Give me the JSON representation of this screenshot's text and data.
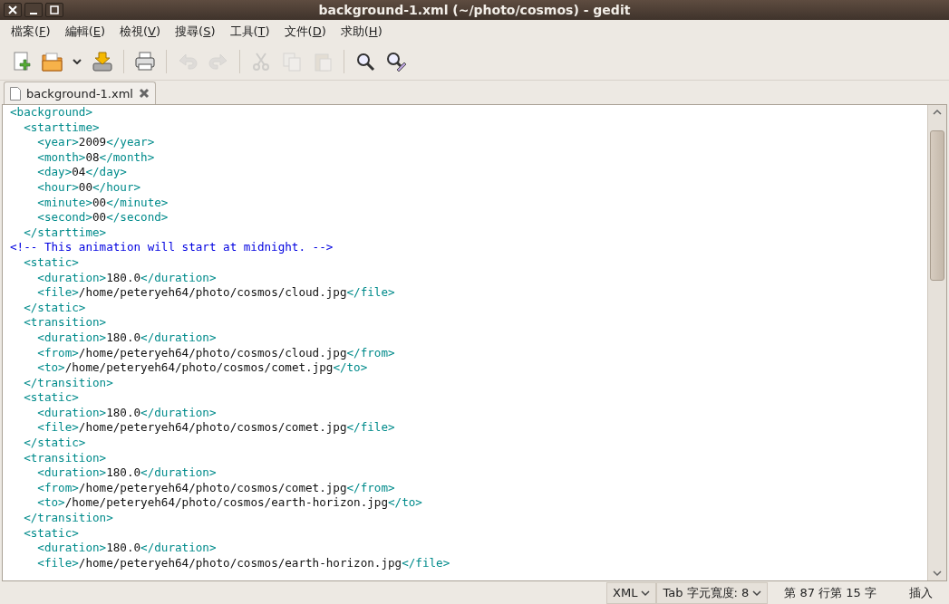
{
  "window": {
    "title": "background-1.xml (~/photo/cosmos) - gedit"
  },
  "menu": [
    {
      "before": "檔案(",
      "key": "F",
      "after": ")"
    },
    {
      "before": "編輯(",
      "key": "E",
      "after": ")"
    },
    {
      "before": "檢視(",
      "key": "V",
      "after": ")"
    },
    {
      "before": "搜尋(",
      "key": "S",
      "after": ")"
    },
    {
      "before": "工具(",
      "key": "T",
      "after": ")"
    },
    {
      "before": "文件(",
      "key": "D",
      "after": ")"
    },
    {
      "before": "求助(",
      "key": "H",
      "after": ")"
    }
  ],
  "toolbar": [
    {
      "kind": "new",
      "disabled": false
    },
    {
      "kind": "open",
      "disabled": false
    },
    {
      "kind": "dropdown",
      "disabled": false
    },
    {
      "kind": "save",
      "disabled": false
    },
    {
      "kind": "separator"
    },
    {
      "kind": "print",
      "disabled": false
    },
    {
      "kind": "separator"
    },
    {
      "kind": "undo",
      "disabled": true
    },
    {
      "kind": "redo",
      "disabled": true
    },
    {
      "kind": "separator"
    },
    {
      "kind": "cut",
      "disabled": true
    },
    {
      "kind": "copy",
      "disabled": true
    },
    {
      "kind": "paste",
      "disabled": true
    },
    {
      "kind": "separator"
    },
    {
      "kind": "find",
      "disabled": false
    },
    {
      "kind": "replace",
      "disabled": false
    }
  ],
  "tabs": [
    {
      "label": "background-1.xml",
      "selected": true
    }
  ],
  "editor": {
    "lines": [
      [
        {
          "kind": "tag",
          "text": "<background>"
        }
      ],
      [
        {
          "kind": "tag",
          "text": "  <starttime>"
        }
      ],
      [
        {
          "kind": "tag",
          "text": "    <year>"
        },
        {
          "kind": "text",
          "text": "2009"
        },
        {
          "kind": "tag",
          "text": "</year>"
        }
      ],
      [
        {
          "kind": "tag",
          "text": "    <month>"
        },
        {
          "kind": "text",
          "text": "08"
        },
        {
          "kind": "tag",
          "text": "</month>"
        }
      ],
      [
        {
          "kind": "tag",
          "text": "    <day>"
        },
        {
          "kind": "text",
          "text": "04"
        },
        {
          "kind": "tag",
          "text": "</day>"
        }
      ],
      [
        {
          "kind": "tag",
          "text": "    <hour>"
        },
        {
          "kind": "text",
          "text": "00"
        },
        {
          "kind": "tag",
          "text": "</hour>"
        }
      ],
      [
        {
          "kind": "tag",
          "text": "    <minute>"
        },
        {
          "kind": "text",
          "text": "00"
        },
        {
          "kind": "tag",
          "text": "</minute>"
        }
      ],
      [
        {
          "kind": "tag",
          "text": "    <second>"
        },
        {
          "kind": "text",
          "text": "00"
        },
        {
          "kind": "tag",
          "text": "</second>"
        }
      ],
      [
        {
          "kind": "tag",
          "text": "  </starttime>"
        }
      ],
      [
        {
          "kind": "comment",
          "text": "<!-- This animation will start at midnight. -->"
        }
      ],
      [
        {
          "kind": "tag",
          "text": "  <static>"
        }
      ],
      [
        {
          "kind": "tag",
          "text": "    <duration>"
        },
        {
          "kind": "text",
          "text": "180.0"
        },
        {
          "kind": "tag",
          "text": "</duration>"
        }
      ],
      [
        {
          "kind": "tag",
          "text": "    <file>"
        },
        {
          "kind": "text",
          "text": "/home/peteryeh64/photo/cosmos/cloud.jpg"
        },
        {
          "kind": "tag",
          "text": "</file>"
        }
      ],
      [
        {
          "kind": "tag",
          "text": "  </static>"
        }
      ],
      [
        {
          "kind": "tag",
          "text": "  <transition>"
        }
      ],
      [
        {
          "kind": "tag",
          "text": "    <duration>"
        },
        {
          "kind": "text",
          "text": "180.0"
        },
        {
          "kind": "tag",
          "text": "</duration>"
        }
      ],
      [
        {
          "kind": "tag",
          "text": "    <from>"
        },
        {
          "kind": "text",
          "text": "/home/peteryeh64/photo/cosmos/cloud.jpg"
        },
        {
          "kind": "tag",
          "text": "</from>"
        }
      ],
      [
        {
          "kind": "tag",
          "text": "    <to>"
        },
        {
          "kind": "text",
          "text": "/home/peteryeh64/photo/cosmos/comet.jpg"
        },
        {
          "kind": "tag",
          "text": "</to>"
        }
      ],
      [
        {
          "kind": "tag",
          "text": "  </transition>"
        }
      ],
      [
        {
          "kind": "tag",
          "text": "  <static>"
        }
      ],
      [
        {
          "kind": "tag",
          "text": "    <duration>"
        },
        {
          "kind": "text",
          "text": "180.0"
        },
        {
          "kind": "tag",
          "text": "</duration>"
        }
      ],
      [
        {
          "kind": "tag",
          "text": "    <file>"
        },
        {
          "kind": "text",
          "text": "/home/peteryeh64/photo/cosmos/comet.jpg"
        },
        {
          "kind": "tag",
          "text": "</file>"
        }
      ],
      [
        {
          "kind": "tag",
          "text": "  </static>"
        }
      ],
      [
        {
          "kind": "tag",
          "text": "  <transition>"
        }
      ],
      [
        {
          "kind": "tag",
          "text": "    <duration>"
        },
        {
          "kind": "text",
          "text": "180.0"
        },
        {
          "kind": "tag",
          "text": "</duration>"
        }
      ],
      [
        {
          "kind": "tag",
          "text": "    <from>"
        },
        {
          "kind": "text",
          "text": "/home/peteryeh64/photo/cosmos/comet.jpg"
        },
        {
          "kind": "tag",
          "text": "</from>"
        }
      ],
      [
        {
          "kind": "tag",
          "text": "    <to>"
        },
        {
          "kind": "text",
          "text": "/home/peteryeh64/photo/cosmos/earth-horizon.jpg"
        },
        {
          "kind": "tag",
          "text": "</to>"
        }
      ],
      [
        {
          "kind": "tag",
          "text": "  </transition>"
        }
      ],
      [
        {
          "kind": "tag",
          "text": "  <static>"
        }
      ],
      [
        {
          "kind": "tag",
          "text": "    <duration>"
        },
        {
          "kind": "text",
          "text": "180.0"
        },
        {
          "kind": "tag",
          "text": "</duration>"
        }
      ],
      [
        {
          "kind": "tag",
          "text": "    <file>"
        },
        {
          "kind": "text",
          "text": "/home/peteryeh64/photo/cosmos/earth-horizon.jpg"
        },
        {
          "kind": "tag",
          "text": "</file>"
        }
      ]
    ]
  },
  "status_bar": {
    "language": "XML",
    "tab_width": "Tab 字元寬度: 8",
    "position": "第 87 行第 15 字",
    "mode": "插入"
  }
}
